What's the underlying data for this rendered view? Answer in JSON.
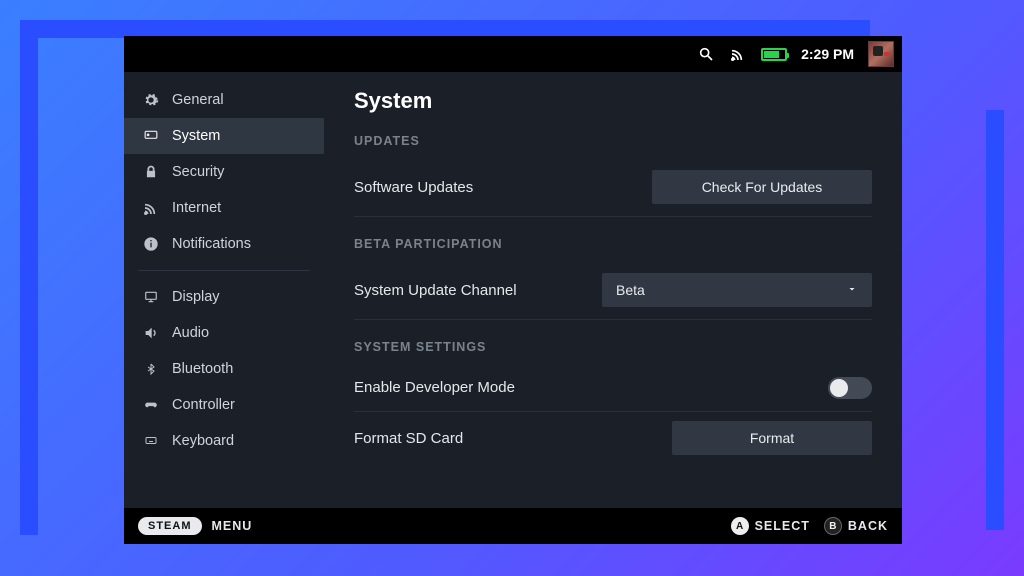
{
  "header": {
    "time": "2:29 PM"
  },
  "sidebar": {
    "group1": [
      {
        "icon": "gear-icon",
        "label": "General"
      },
      {
        "icon": "device-icon",
        "label": "System",
        "active": true
      },
      {
        "icon": "lock-icon",
        "label": "Security"
      },
      {
        "icon": "wifi-icon",
        "label": "Internet"
      },
      {
        "icon": "info-icon",
        "label": "Notifications"
      }
    ],
    "group2": [
      {
        "icon": "display-icon",
        "label": "Display"
      },
      {
        "icon": "audio-icon",
        "label": "Audio"
      },
      {
        "icon": "bluetooth-icon",
        "label": "Bluetooth"
      },
      {
        "icon": "controller-icon",
        "label": "Controller"
      },
      {
        "icon": "keyboard-icon",
        "label": "Keyboard"
      }
    ]
  },
  "main": {
    "title": "System",
    "sections": {
      "updates": {
        "heading": "UPDATES",
        "software_label": "Software Updates",
        "check_button": "Check For Updates"
      },
      "beta": {
        "heading": "BETA PARTICIPATION",
        "channel_label": "System Update Channel",
        "channel_value": "Beta"
      },
      "settings": {
        "heading": "SYSTEM SETTINGS",
        "dev_label": "Enable Developer Mode",
        "dev_value": false,
        "format_label": "Format SD Card",
        "format_button": "Format"
      }
    }
  },
  "footer": {
    "steam": "STEAM",
    "menu": "MENU",
    "a_label": "SELECT",
    "b_label": "BACK"
  }
}
